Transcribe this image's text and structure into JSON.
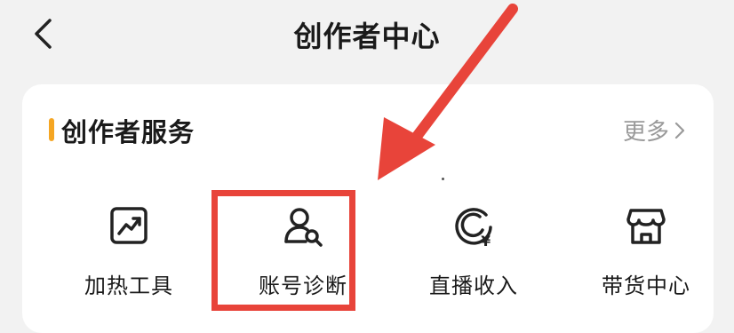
{
  "header": {
    "title": "创作者中心",
    "back_icon": "chevron-left-icon"
  },
  "section": {
    "title": "创作者服务",
    "more_label": "更多",
    "accent_color": "#f5a623"
  },
  "tools": [
    {
      "label": "加热工具",
      "icon": "trending-chart-icon"
    },
    {
      "label": "账号诊断",
      "icon": "user-search-icon"
    },
    {
      "label": "直播收入",
      "icon": "live-income-icon"
    },
    {
      "label": "带货中心",
      "icon": "storefront-icon"
    }
  ],
  "annotation": {
    "color": "#e8443a"
  }
}
